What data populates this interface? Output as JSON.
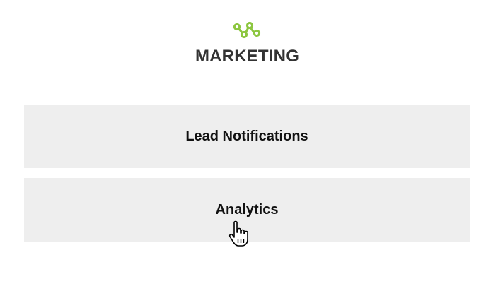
{
  "header": {
    "logo_icon": "network-nodes-icon",
    "title": "MARKETING",
    "accent_color": "#8cc63f"
  },
  "menu": {
    "items": [
      {
        "label": "Lead Notifications"
      },
      {
        "label": "Analytics"
      }
    ],
    "card_color": "#eeeeee"
  },
  "cursor": {
    "icon": "hand-pointer-icon"
  }
}
